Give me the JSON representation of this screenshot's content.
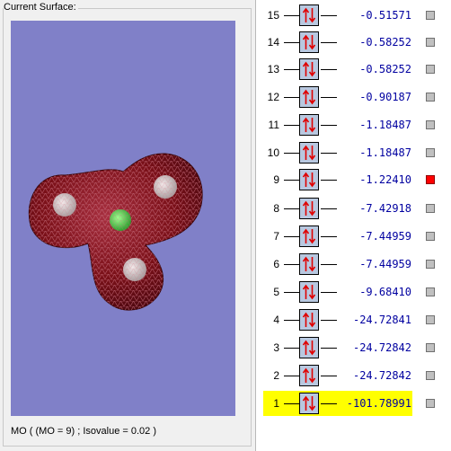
{
  "surface_panel": {
    "group_title": "Current Surface:",
    "caption": "MO ( (MO = 9) ; Isovalue = 0.02 )",
    "background_color": "#8080c8",
    "surface_color": "#7a1018",
    "central_atom_color": "#40d040",
    "outer_atom_color": "#e8e8e8"
  },
  "mo_list": {
    "occupancy_glyph": "up-down-arrows-icon",
    "selected_color": "#ff0000",
    "highlight_color": "#ffff00",
    "orbitals": [
      {
        "index": "15",
        "energy": "-0.51571",
        "selected": false,
        "highlight": false
      },
      {
        "index": "14",
        "energy": "-0.58252",
        "selected": false,
        "highlight": false
      },
      {
        "index": "13",
        "energy": "-0.58252",
        "selected": false,
        "highlight": false
      },
      {
        "index": "12",
        "energy": "-0.90187",
        "selected": false,
        "highlight": false
      },
      {
        "index": "11",
        "energy": "-1.18487",
        "selected": false,
        "highlight": false
      },
      {
        "index": "10",
        "energy": "-1.18487",
        "selected": false,
        "highlight": false
      },
      {
        "index": "9",
        "energy": "-1.22410",
        "selected": true,
        "highlight": false
      },
      {
        "index": "8",
        "energy": "-7.42918",
        "selected": false,
        "highlight": false
      },
      {
        "index": "7",
        "energy": "-7.44959",
        "selected": false,
        "highlight": false
      },
      {
        "index": "6",
        "energy": "-7.44959",
        "selected": false,
        "highlight": false
      },
      {
        "index": "5",
        "energy": "-9.68410",
        "selected": false,
        "highlight": false
      },
      {
        "index": "4",
        "energy": "-24.72841",
        "selected": false,
        "highlight": false
      },
      {
        "index": "3",
        "energy": "-24.72842",
        "selected": false,
        "highlight": false
      },
      {
        "index": "2",
        "energy": "-24.72842",
        "selected": false,
        "highlight": false
      },
      {
        "index": "1",
        "energy": "-101.78991",
        "selected": false,
        "highlight": true
      }
    ]
  }
}
